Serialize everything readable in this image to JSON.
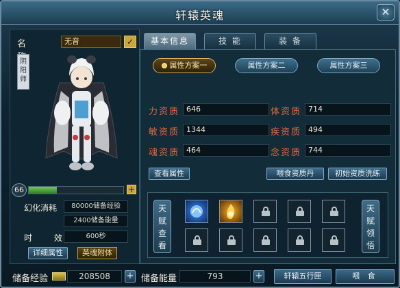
{
  "window": {
    "title": "轩辕英魂",
    "close_icon": "✕"
  },
  "name": {
    "label": "名 称",
    "value": "无音",
    "confirm_icon": "✓"
  },
  "class_badge": "阴\n阳\n师",
  "level": {
    "value": "66",
    "progress": 0.3,
    "plus": "+"
  },
  "stats": {
    "consume_label": "幻化消耗",
    "consume_exp": "80000储备经验",
    "consume_energy": "2400储备能量",
    "duration_label": "时 效",
    "duration_value": "600秒"
  },
  "left_buttons": {
    "detail": "详细属性",
    "possess": "英魂附体"
  },
  "tabs": [
    "基本信息",
    "技 能",
    "装 备"
  ],
  "schemes": [
    "属性方案一",
    "属性方案二",
    "属性方案三"
  ],
  "aptitudes": [
    {
      "label": "力资质",
      "value": "646"
    },
    {
      "label": "体资质",
      "value": "714"
    },
    {
      "label": "敏资质",
      "value": "1344"
    },
    {
      "label": "疾资质",
      "value": "494"
    },
    {
      "label": "魂资质",
      "value": "464"
    },
    {
      "label": "念资质",
      "value": "744"
    }
  ],
  "actions": {
    "view_attr": "查看属性",
    "feed_up": "喂食资质丹",
    "wash": "初始资质洗练"
  },
  "talent": {
    "view": "天\n赋\n查\n看",
    "comprehend": "天\n赋\n领\n悟"
  },
  "bottom": {
    "exp_label": "储备经验",
    "exp_value": "208508",
    "energy_label": "储备能量",
    "energy_value": "793",
    "wuxing_button": "轩辕五行匣",
    "feed_button": "喂 食",
    "plus": "+"
  },
  "colors": {
    "accent_gold": "#c9a53a",
    "aptitude_label": "#e6643a",
    "panel": "#132c3a"
  }
}
